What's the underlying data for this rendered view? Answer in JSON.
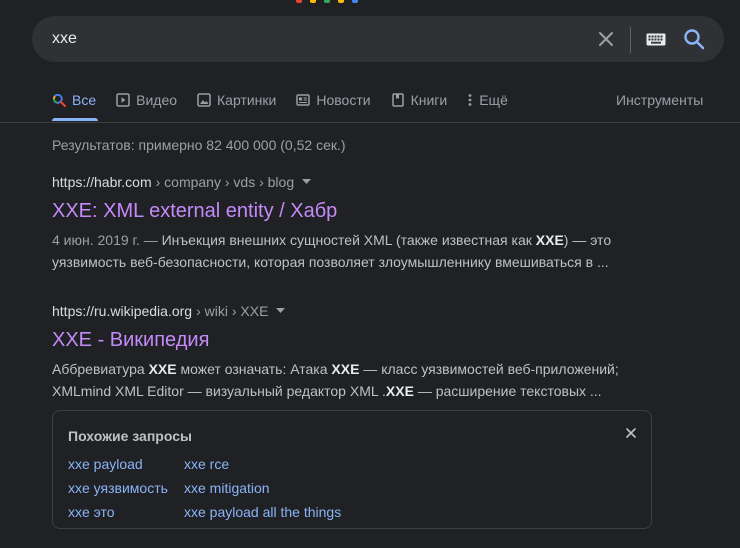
{
  "colors": {
    "background": "#202124",
    "search_box": "#303134",
    "link_blue": "#8ab4f8",
    "visited_purple": "#c58af9",
    "text": "#bdc1c6",
    "muted": "#9aa0a6"
  },
  "search": {
    "query": "xxe",
    "icons": [
      "close-icon",
      "keyboard-icon",
      "search-icon"
    ]
  },
  "tabs": [
    {
      "label": "Все",
      "icon": "search-icon",
      "active": true
    },
    {
      "label": "Видео",
      "icon": "play-icon"
    },
    {
      "label": "Картинки",
      "icon": "image-icon"
    },
    {
      "label": "Новости",
      "icon": "news-icon"
    },
    {
      "label": "Книги",
      "icon": "book-icon"
    },
    {
      "label": "Ещё",
      "icon": "more-vert-icon"
    }
  ],
  "tools_label": "Инструменты",
  "stats": "Результатов: примерно 82 400 000 (0,52 сек.)",
  "results": [
    {
      "host": "https://habr.com",
      "path": "› company › vds › blog",
      "title": "XXE: XML external entity / Хабр",
      "date": "4 июн. 2019 г. —",
      "snippet_1": " Инъекция внешних сущностей XML (также известная как ",
      "snippet_1_bold": "XXE",
      "snippet_1_tail": ") — это",
      "snippet_2": "уязвимость веб-безопасности, которая позволяет злоумышленнику вмешиваться в ..."
    },
    {
      "host": "https://ru.wikipedia.org",
      "path": "› wiki › XXE",
      "title": "XXE - Википедия",
      "snippet_1a": "Аббревиатура ",
      "snippet_1_bold_a": "XXE",
      "snippet_1b": " может означать: Атака ",
      "snippet_1_bold_b": "XXE",
      "snippet_1c": " — класс уязвимостей веб-приложений;",
      "snippet_2a": "XMLmind XML Editor — визуальный редактор XML .",
      "snippet_2_bold": "XXE",
      "snippet_2b": " — расширение текстовых ..."
    }
  ],
  "related": {
    "title": "Похожие запросы",
    "items": [
      "xxe payload",
      "xxe rce",
      "xxe уязвимость",
      "xxe mitigation",
      "xxe это",
      "xxe payload all the things"
    ]
  }
}
